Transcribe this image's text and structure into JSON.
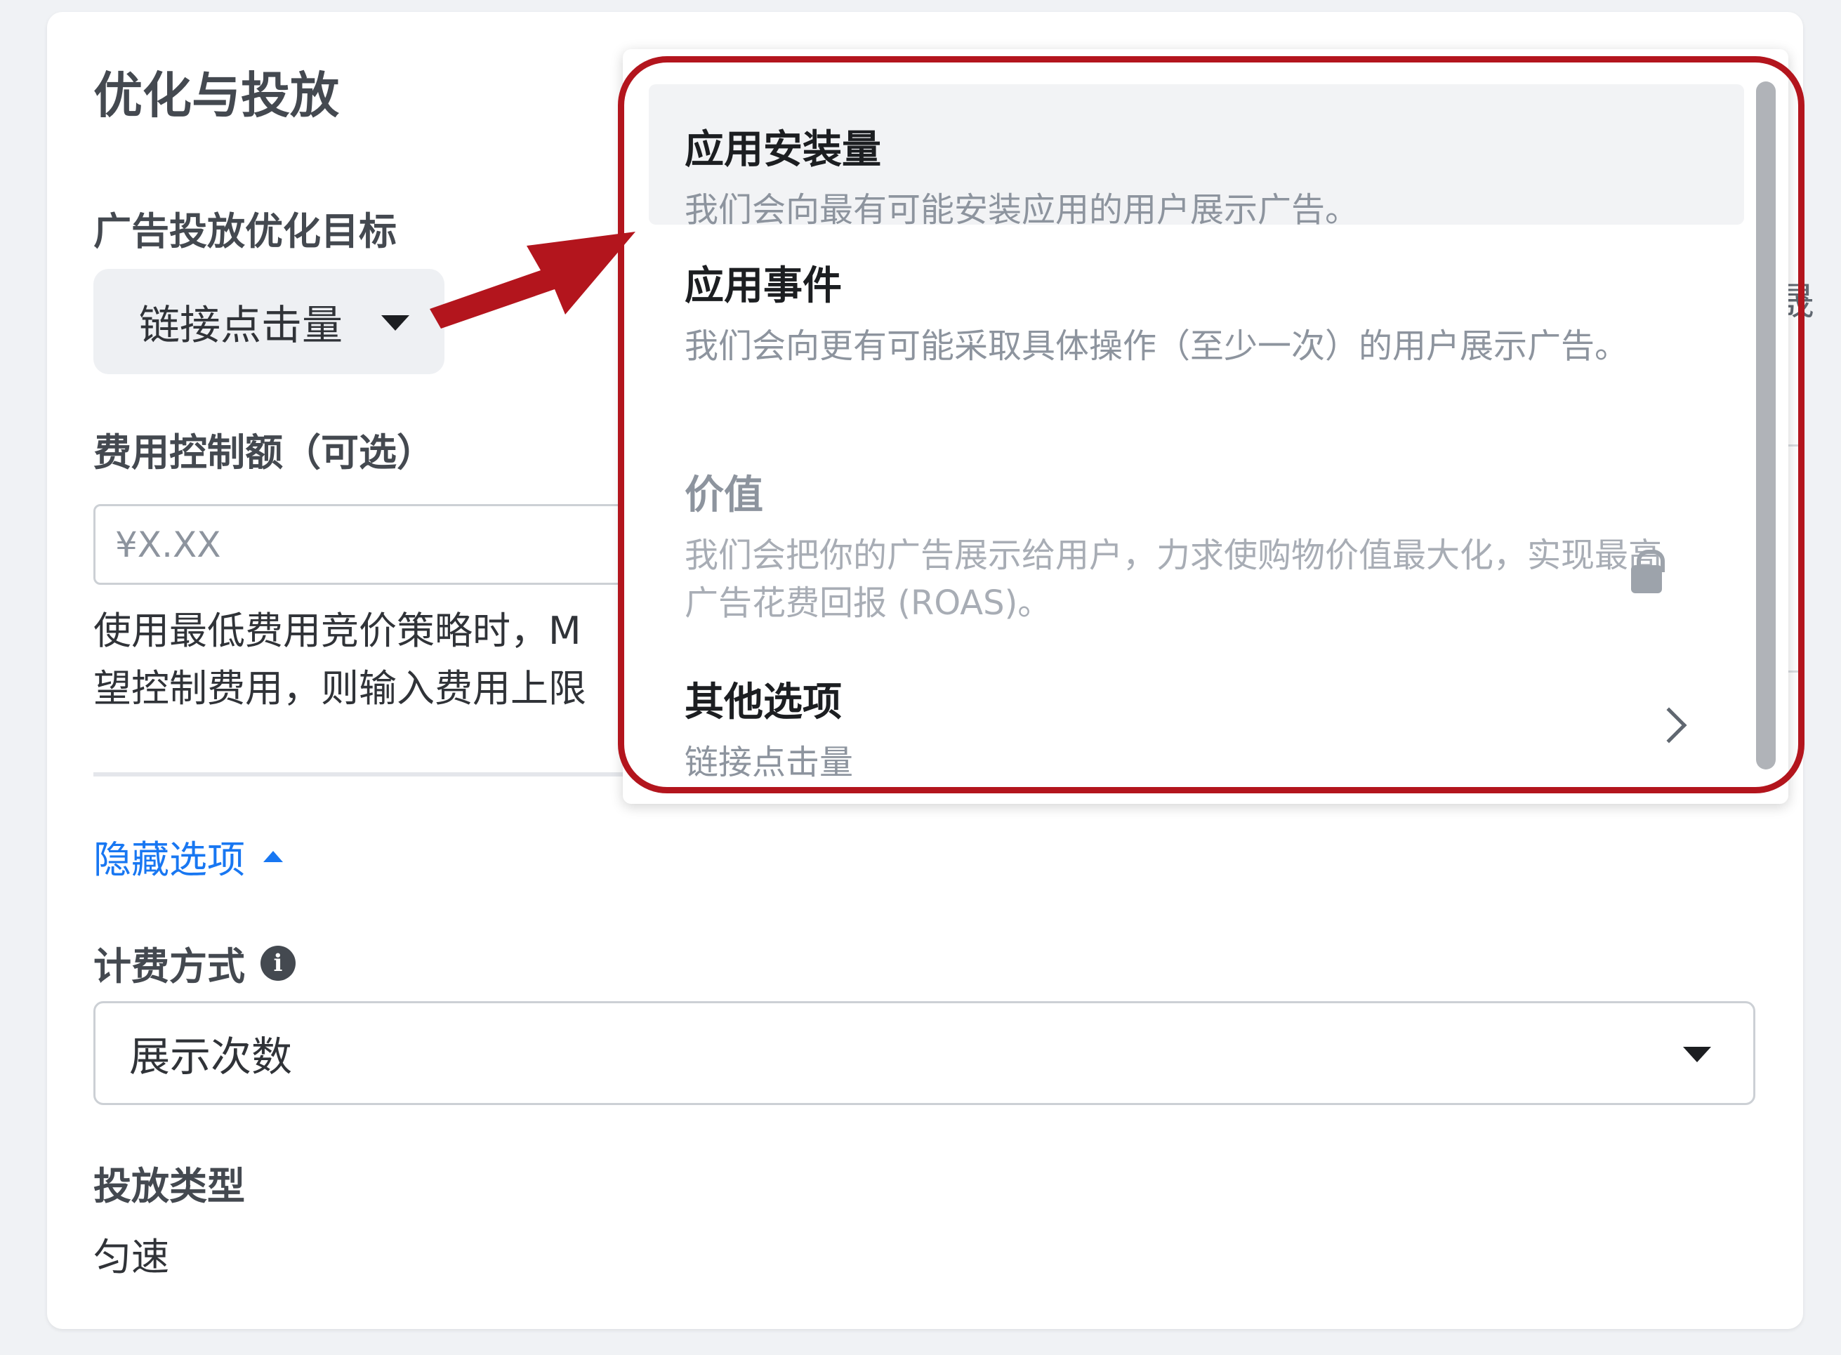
{
  "section": {
    "title": "优化与投放"
  },
  "optimization_goal": {
    "label": "广告投放优化目标",
    "selected": "链接点击量"
  },
  "cost_control": {
    "label": "费用控制额（可选）",
    "placeholder": "¥X.XX",
    "help_line1": "使用最低费用竞价策略时，M",
    "help_line2": "望控制费用，则输入费用上限"
  },
  "hide_options": {
    "label": "隐藏选项"
  },
  "billing": {
    "label": "计费方式",
    "info_glyph": "i",
    "selected": "展示次数"
  },
  "delivery_type": {
    "label": "投放类型",
    "value": "匀速"
  },
  "dropdown": {
    "items": [
      {
        "title": "应用安装量",
        "desc": "我们会向最有可能安装应用的用户展示广告。",
        "state": "highlighted"
      },
      {
        "title": "应用事件",
        "desc": "我们会向更有可能采取具体操作（至少一次）的用户展示广告。",
        "state": "enabled"
      },
      {
        "title": "价值",
        "desc": "我们会把你的广告展示给用户，力求使购物价值最大化，实现最高广告花费回报 (ROAS)。",
        "state": "locked",
        "icon": "lock-icon"
      },
      {
        "title": "其他选项",
        "desc": "链接点击量",
        "state": "submenu",
        "icon": "chevron-right-icon"
      }
    ]
  },
  "annotation_colors": {
    "highlight": "#b3151d",
    "arrow": "#b3151d"
  },
  "partial_edge_text": "晟"
}
